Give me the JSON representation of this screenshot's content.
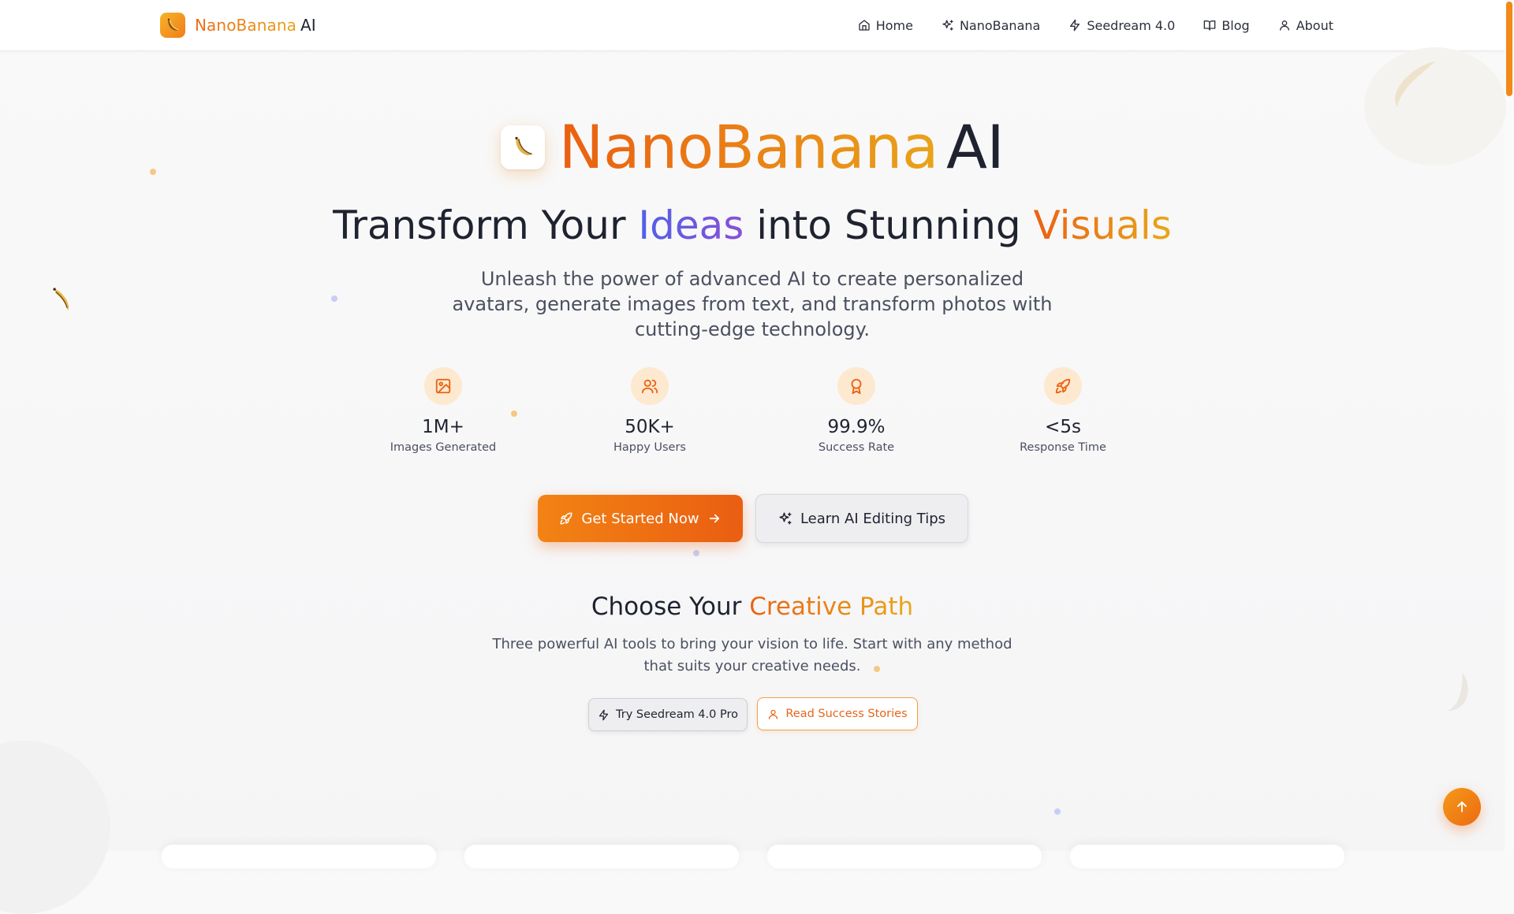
{
  "brand": {
    "name": "NanoBanana",
    "suffix": "AI"
  },
  "nav": {
    "items": [
      {
        "label": "Home",
        "icon": "home-icon"
      },
      {
        "label": "NanoBanana",
        "icon": "sparkles-icon"
      },
      {
        "label": "Seedream 4.0",
        "icon": "zap-icon"
      },
      {
        "label": "Blog",
        "icon": "book-icon"
      },
      {
        "label": "About",
        "icon": "user-icon"
      }
    ]
  },
  "hero": {
    "title_name": "NanoBanana",
    "title_suffix": "AI",
    "subtitle": {
      "part1": "Transform Your ",
      "highlight1": "Ideas",
      "part2": " into Stunning ",
      "highlight2": "Visuals"
    },
    "lead": "Unleash the power of advanced AI to create personalized avatars, generate images from text, and transform photos with cutting-edge technology."
  },
  "stats": [
    {
      "value": "1M+",
      "label": "Images Generated",
      "icon": "image-icon"
    },
    {
      "value": "50K+",
      "label": "Happy Users",
      "icon": "users-icon"
    },
    {
      "value": "99.9%",
      "label": "Success Rate",
      "icon": "award-icon"
    },
    {
      "value": "<5s",
      "label": "Response Time",
      "icon": "rocket-icon"
    }
  ],
  "cta": {
    "primary": "Get Started Now",
    "secondary": "Learn AI Editing Tips"
  },
  "paths": {
    "title_prefix": "Choose Your ",
    "title_highlight": "Creative Path",
    "description": "Three powerful AI tools to bring your vision to life. Start with any method that suits your creative needs.",
    "button_seedream": "Try Seedream 4.0 Pro",
    "button_stories": "Read Success Stories"
  },
  "colors": {
    "accent": "#f28313",
    "accent_dark": "#ea5e12",
    "indigo": "#4f61e8",
    "text": "#1f2330",
    "muted": "#4b5060"
  }
}
